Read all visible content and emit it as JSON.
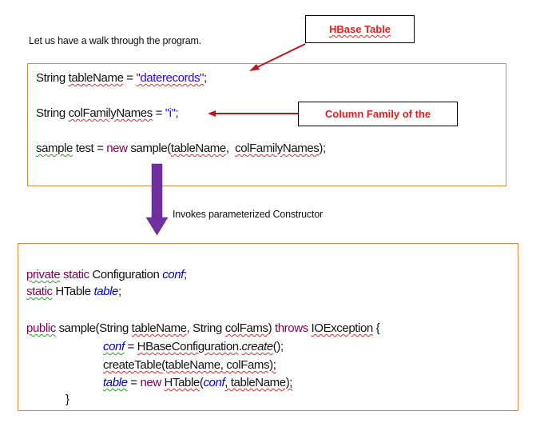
{
  "intro_text": "Let us have a walk through the program.",
  "callouts": {
    "hbase_table": "HBase Table",
    "column_family": "Column Family of the"
  },
  "snippet1": {
    "line1": {
      "type": "String",
      "var": "tableName",
      "eq": " = ",
      "value": "\"daterecords\"",
      "end": ";"
    },
    "line2": {
      "type": "String",
      "var": "colFamilyNames",
      "eq": " = ",
      "value": "\"i\"",
      "end": ";"
    },
    "line3": {
      "cls": "sample",
      "rest1": " test = ",
      "kw_new": "new",
      "call": " sample(",
      "arg1": "tableName",
      "sep": ",  ",
      "arg2": "colFamilyNames",
      "end": ");"
    }
  },
  "arrow_note": "Invokes parameterized Constructor",
  "snippet2": {
    "l1": {
      "kw1": "private",
      "kw2": " static",
      "type": " Configuration ",
      "field": "conf",
      "end": ";"
    },
    "l2": {
      "kw": "static",
      "type": " HTable ",
      "field": "table",
      "end": ";"
    },
    "l3": {
      "kw": "public",
      "sig1": " sample(String ",
      "p1": "tableName",
      "sig2": ", String ",
      "p2": "colFams",
      "sig3": ") ",
      "kw_throws": "throws",
      "sp": " ",
      "exc": "IOException",
      "end": " {"
    },
    "l4": {
      "field": "conf",
      "eq": " = ",
      "cls": "HBaseConfiguration",
      "dot": ".",
      "method": "create",
      "end": "();"
    },
    "l5": {
      "call": "createTable",
      "args": "(tableName, colFams);"
    },
    "l6": {
      "field": "table",
      "eq": " = ",
      "kw_new": "new",
      "sp": " ",
      "cls": "HTable",
      "open": "(",
      "arg1": "conf",
      "rest": ", tableName);"
    },
    "l7": "}"
  },
  "colors": {
    "box_border": "#e08a3c",
    "callout_text": "#e02020",
    "arrow_red": "#c0141c",
    "arrow_purple": "#7030a0",
    "keyword": "#7f0055",
    "string": "#2a00ff",
    "field": "#0000c0"
  }
}
